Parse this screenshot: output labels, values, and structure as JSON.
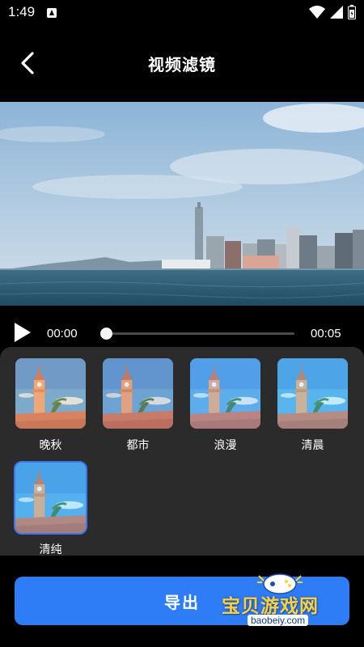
{
  "status_bar": {
    "time": "1:49"
  },
  "header": {
    "title": "视频滤镜"
  },
  "player": {
    "current_time": "00:00",
    "total_time": "00:05",
    "progress": 0
  },
  "filters": [
    {
      "label": "晚秋",
      "tone": "#ffbf86"
    },
    {
      "label": "都市",
      "tone": "#c9a6a1"
    },
    {
      "label": "浪漫",
      "tone": "#8fc8ff"
    },
    {
      "label": "清晨",
      "tone": "#7ee3ff"
    },
    {
      "label": "清纯",
      "tone": "#72d7ff"
    }
  ],
  "selected_filter": 4,
  "export": {
    "label": "导出"
  },
  "watermark": {
    "text": "宝贝游戏网",
    "url": "baobeiy.com"
  },
  "colors": {
    "accent": "#2f7df6",
    "panel": "#2b2b2b",
    "background": "#000000"
  }
}
